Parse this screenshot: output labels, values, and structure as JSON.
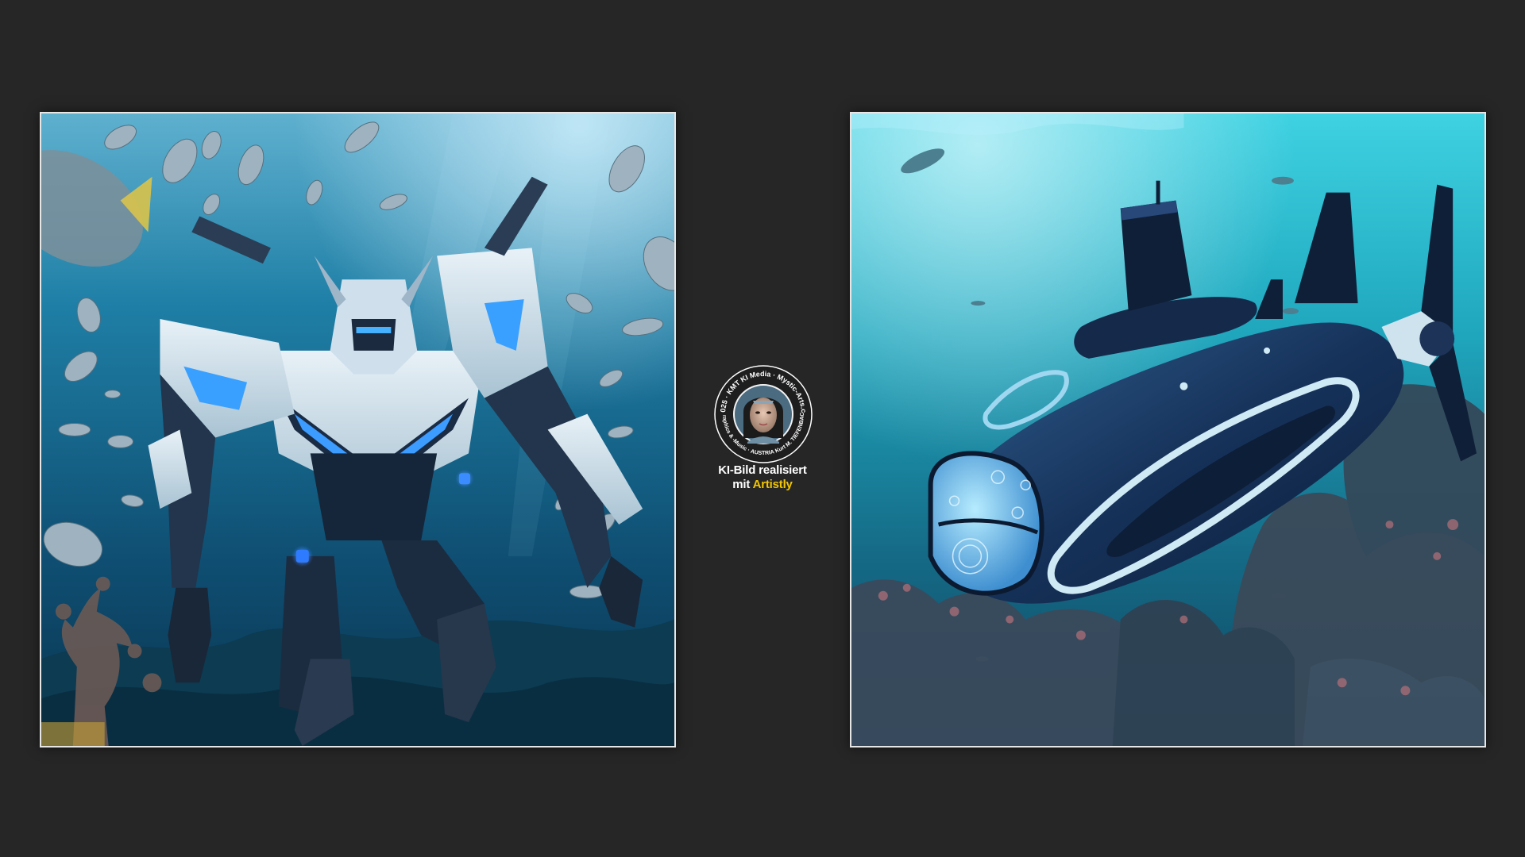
{
  "images": {
    "left": {
      "alt": "blue-white mech robot swimming underwater among fish"
    },
    "right": {
      "alt": "dark blue futuristic submarine above coral reef"
    }
  },
  "badge": {
    "ring_text_top": "© 2025 · KMT KI Media · Mystic-Arts.com",
    "ring_text_bottom": "KMTonne | AI-Graphics & -Music · AUSTRIA Kurt M. TIEFENBACH · AI-Music.at",
    "icon": "portrait-icon"
  },
  "caption": {
    "line1": "KI-Bild realisiert",
    "line2_prefix": "mit",
    "line2_brand": "Artistly"
  },
  "colors": {
    "background": "#262626",
    "frame_border": "#e6e6e6",
    "brand": "#f2c500"
  }
}
